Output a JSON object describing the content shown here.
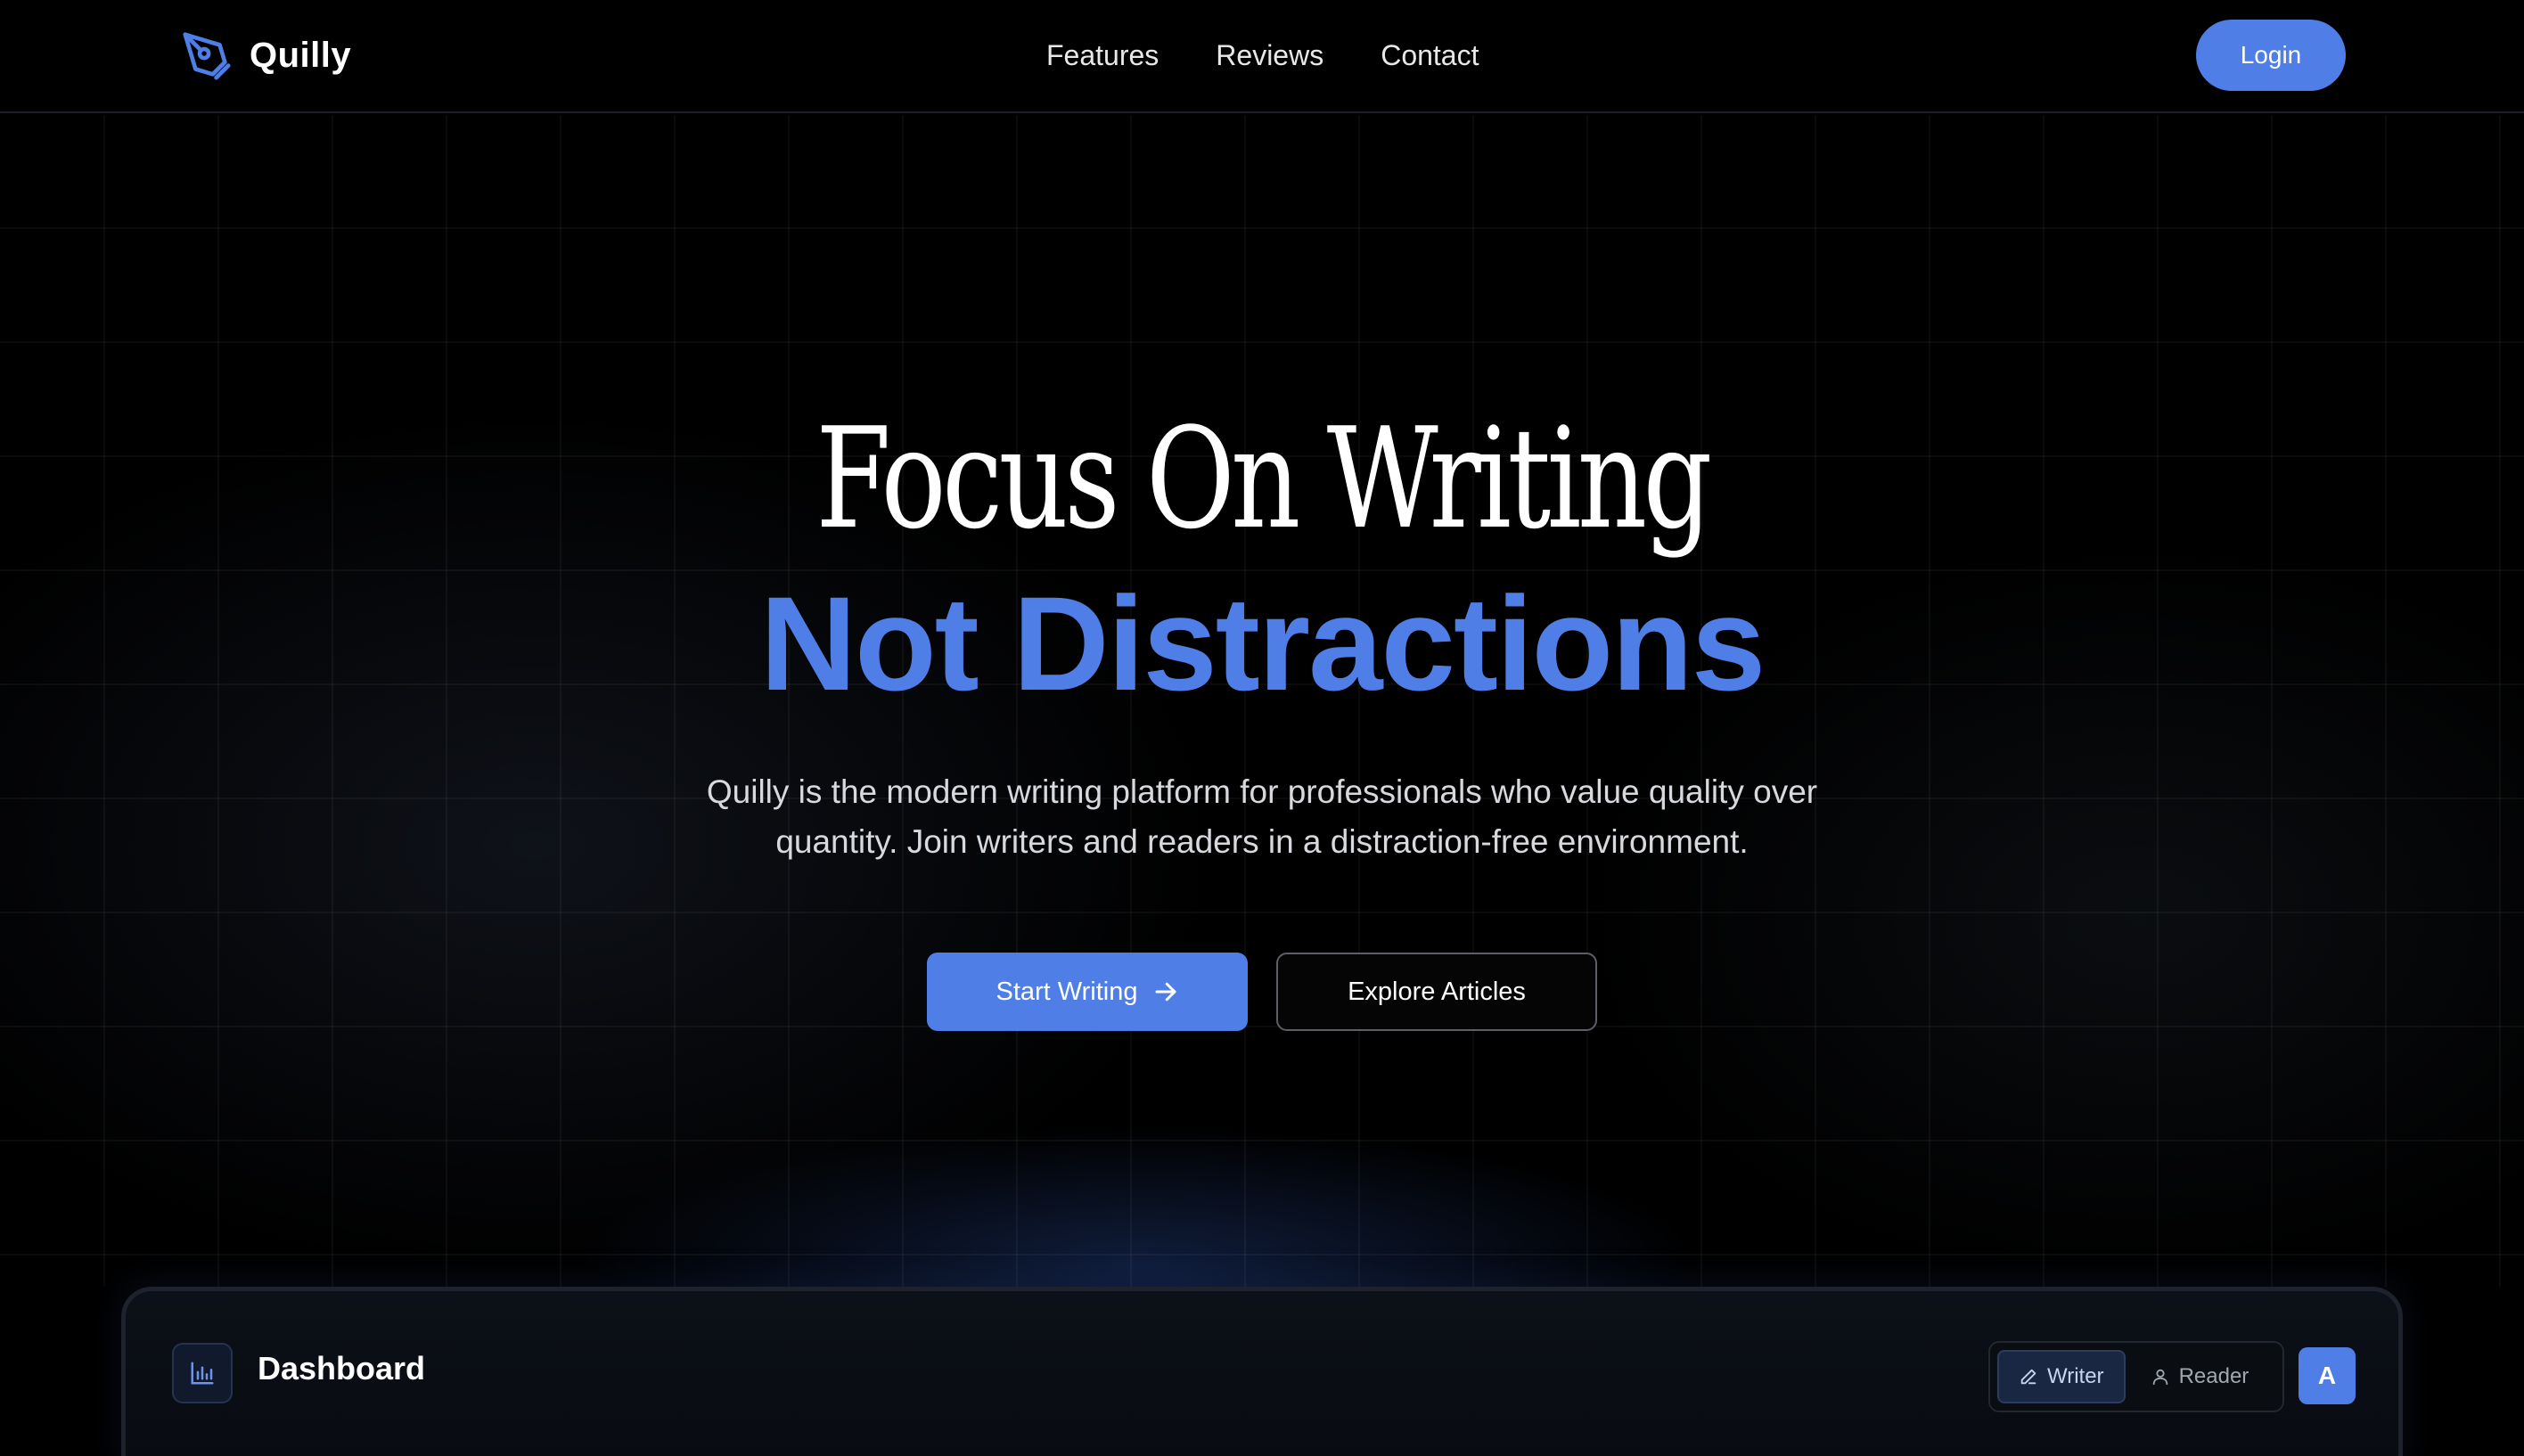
{
  "brand": {
    "name": "Quilly",
    "icon": "pen-nib-icon",
    "accent": "#4f7fe6"
  },
  "nav": {
    "items": [
      {
        "label": "Features"
      },
      {
        "label": "Reviews"
      },
      {
        "label": "Contact"
      }
    ]
  },
  "header": {
    "login_label": "Login"
  },
  "hero": {
    "title_line1": "Focus On Writing",
    "title_line2": "Not Distractions",
    "subtitle_line1": "Quilly is the modern writing platform for professionals who value quality over",
    "subtitle_line2": "quantity. Join writers and readers in a distraction-free environment.",
    "primary_cta": "Start Writing",
    "primary_cta_icon": "arrow-right-icon",
    "secondary_cta": "Explore Articles"
  },
  "dashboard": {
    "icon": "bar-chart-icon",
    "title": "Dashboard",
    "modes": [
      {
        "label": "Writer",
        "icon": "pencil-icon",
        "active": true
      },
      {
        "label": "Reader",
        "icon": "user-icon",
        "active": false
      }
    ],
    "avatar_initial": "A"
  }
}
